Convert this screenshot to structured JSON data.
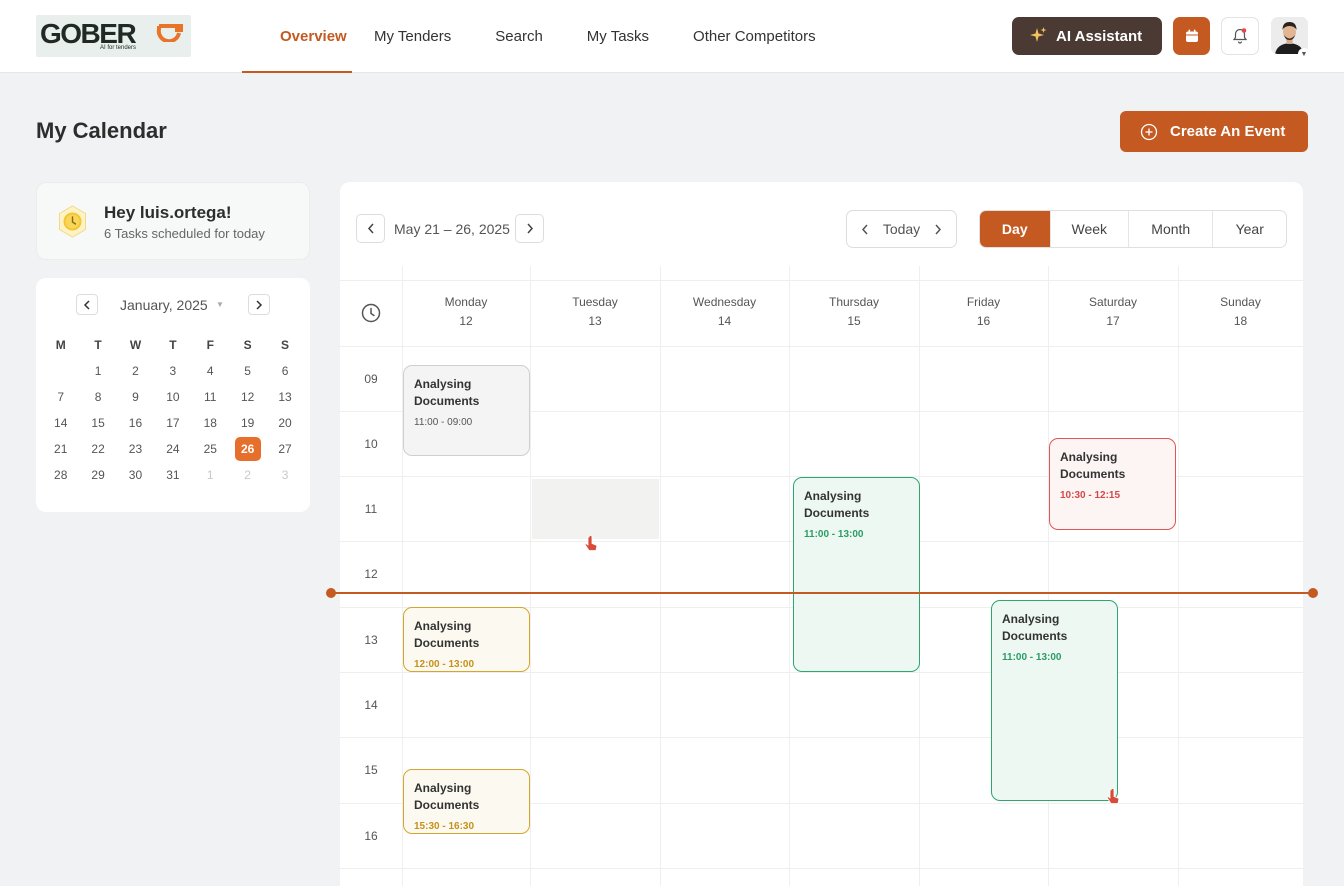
{
  "header": {
    "logo_text": "GOBER",
    "logo_tagline": "AI for tenders",
    "nav": [
      {
        "label": "Overview",
        "active": true
      },
      {
        "label": "My Tenders"
      },
      {
        "label": "Search"
      },
      {
        "label": "My Tasks"
      },
      {
        "label": "Other Competitors"
      }
    ],
    "ai_button": "AI Assistant"
  },
  "page": {
    "title": "My Calendar",
    "create_button": "Create An Event"
  },
  "greeting": {
    "name": "Hey luis.ortega!",
    "subtitle": "6 Tasks scheduled for today"
  },
  "mini_calendar": {
    "month_label": "January, 2025",
    "weekdays": [
      "M",
      "T",
      "W",
      "T",
      "F",
      "S",
      "S"
    ],
    "days": [
      "",
      "1",
      "2",
      "3",
      "4",
      "5",
      "6",
      "7",
      "8",
      "9",
      "10",
      "11",
      "12",
      "13",
      "14",
      "15",
      "16",
      "17",
      "18",
      "19",
      "20",
      "21",
      "22",
      "23",
      "24",
      "25",
      "26",
      "27",
      "28",
      "29",
      "30",
      "31",
      "1",
      "2",
      "3"
    ],
    "selected_day": "26"
  },
  "calendar": {
    "range_label": "May 21 – 26, 2025",
    "today_label": "Today",
    "views": [
      "Day",
      "Week",
      "Month",
      "Year"
    ],
    "active_view": "Day",
    "days": [
      {
        "name": "Monday",
        "num": "12"
      },
      {
        "name": "Tuesday",
        "num": "13"
      },
      {
        "name": "Wednesday",
        "num": "14"
      },
      {
        "name": "Thursday",
        "num": "15"
      },
      {
        "name": "Friday",
        "num": "16"
      },
      {
        "name": "Saturday",
        "num": "17"
      },
      {
        "name": "Sunday",
        "num": "18"
      }
    ],
    "hours": [
      "09",
      "10",
      "11",
      "12",
      "13",
      "14",
      "15",
      "16"
    ],
    "events": [
      {
        "title": "Analysing Documents",
        "time": "11:00 - 09:00",
        "color": "gray"
      },
      {
        "title": "Analysing Documents",
        "time": "12:00 - 13:00",
        "color": "yellow"
      },
      {
        "title": "Analysing Documents",
        "time": "15:30 - 16:30",
        "color": "yellow"
      },
      {
        "title": "Analysing Documents",
        "time": "11:00 - 13:00",
        "color": "green"
      },
      {
        "title": "Analysing Documents",
        "time": "11:00 - 13:00",
        "color": "green"
      },
      {
        "title": "Analysing Documents",
        "time": "10:30 - 12:15",
        "color": "red"
      }
    ]
  },
  "colors": {
    "accent": "#c45a22",
    "ai_button_bg": "#4a3a33"
  }
}
